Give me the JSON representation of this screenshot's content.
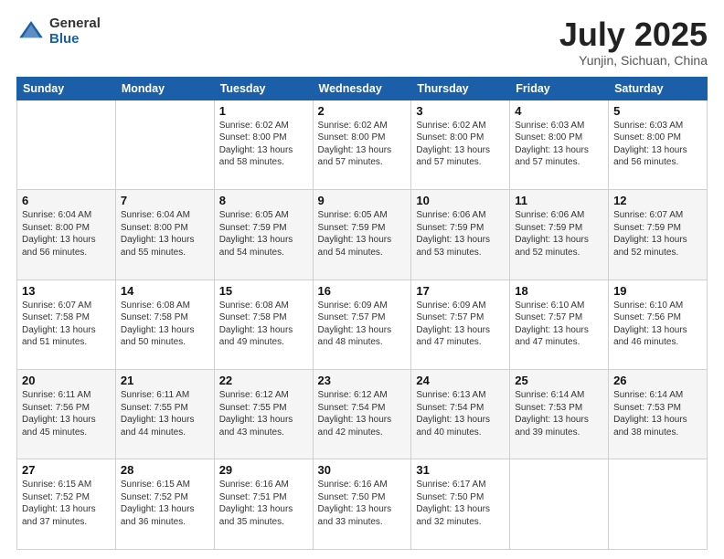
{
  "logo": {
    "general": "General",
    "blue": "Blue"
  },
  "header": {
    "month": "July 2025",
    "location": "Yunjin, Sichuan, China"
  },
  "weekdays": [
    "Sunday",
    "Monday",
    "Tuesday",
    "Wednesday",
    "Thursday",
    "Friday",
    "Saturday"
  ],
  "weeks": [
    [
      {
        "day": "",
        "info": ""
      },
      {
        "day": "",
        "info": ""
      },
      {
        "day": "1",
        "info": "Sunrise: 6:02 AM\nSunset: 8:00 PM\nDaylight: 13 hours and 58 minutes."
      },
      {
        "day": "2",
        "info": "Sunrise: 6:02 AM\nSunset: 8:00 PM\nDaylight: 13 hours and 57 minutes."
      },
      {
        "day": "3",
        "info": "Sunrise: 6:02 AM\nSunset: 8:00 PM\nDaylight: 13 hours and 57 minutes."
      },
      {
        "day": "4",
        "info": "Sunrise: 6:03 AM\nSunset: 8:00 PM\nDaylight: 13 hours and 57 minutes."
      },
      {
        "day": "5",
        "info": "Sunrise: 6:03 AM\nSunset: 8:00 PM\nDaylight: 13 hours and 56 minutes."
      }
    ],
    [
      {
        "day": "6",
        "info": "Sunrise: 6:04 AM\nSunset: 8:00 PM\nDaylight: 13 hours and 56 minutes."
      },
      {
        "day": "7",
        "info": "Sunrise: 6:04 AM\nSunset: 8:00 PM\nDaylight: 13 hours and 55 minutes."
      },
      {
        "day": "8",
        "info": "Sunrise: 6:05 AM\nSunset: 7:59 PM\nDaylight: 13 hours and 54 minutes."
      },
      {
        "day": "9",
        "info": "Sunrise: 6:05 AM\nSunset: 7:59 PM\nDaylight: 13 hours and 54 minutes."
      },
      {
        "day": "10",
        "info": "Sunrise: 6:06 AM\nSunset: 7:59 PM\nDaylight: 13 hours and 53 minutes."
      },
      {
        "day": "11",
        "info": "Sunrise: 6:06 AM\nSunset: 7:59 PM\nDaylight: 13 hours and 52 minutes."
      },
      {
        "day": "12",
        "info": "Sunrise: 6:07 AM\nSunset: 7:59 PM\nDaylight: 13 hours and 52 minutes."
      }
    ],
    [
      {
        "day": "13",
        "info": "Sunrise: 6:07 AM\nSunset: 7:58 PM\nDaylight: 13 hours and 51 minutes."
      },
      {
        "day": "14",
        "info": "Sunrise: 6:08 AM\nSunset: 7:58 PM\nDaylight: 13 hours and 50 minutes."
      },
      {
        "day": "15",
        "info": "Sunrise: 6:08 AM\nSunset: 7:58 PM\nDaylight: 13 hours and 49 minutes."
      },
      {
        "day": "16",
        "info": "Sunrise: 6:09 AM\nSunset: 7:57 PM\nDaylight: 13 hours and 48 minutes."
      },
      {
        "day": "17",
        "info": "Sunrise: 6:09 AM\nSunset: 7:57 PM\nDaylight: 13 hours and 47 minutes."
      },
      {
        "day": "18",
        "info": "Sunrise: 6:10 AM\nSunset: 7:57 PM\nDaylight: 13 hours and 47 minutes."
      },
      {
        "day": "19",
        "info": "Sunrise: 6:10 AM\nSunset: 7:56 PM\nDaylight: 13 hours and 46 minutes."
      }
    ],
    [
      {
        "day": "20",
        "info": "Sunrise: 6:11 AM\nSunset: 7:56 PM\nDaylight: 13 hours and 45 minutes."
      },
      {
        "day": "21",
        "info": "Sunrise: 6:11 AM\nSunset: 7:55 PM\nDaylight: 13 hours and 44 minutes."
      },
      {
        "day": "22",
        "info": "Sunrise: 6:12 AM\nSunset: 7:55 PM\nDaylight: 13 hours and 43 minutes."
      },
      {
        "day": "23",
        "info": "Sunrise: 6:12 AM\nSunset: 7:54 PM\nDaylight: 13 hours and 42 minutes."
      },
      {
        "day": "24",
        "info": "Sunrise: 6:13 AM\nSunset: 7:54 PM\nDaylight: 13 hours and 40 minutes."
      },
      {
        "day": "25",
        "info": "Sunrise: 6:14 AM\nSunset: 7:53 PM\nDaylight: 13 hours and 39 minutes."
      },
      {
        "day": "26",
        "info": "Sunrise: 6:14 AM\nSunset: 7:53 PM\nDaylight: 13 hours and 38 minutes."
      }
    ],
    [
      {
        "day": "27",
        "info": "Sunrise: 6:15 AM\nSunset: 7:52 PM\nDaylight: 13 hours and 37 minutes."
      },
      {
        "day": "28",
        "info": "Sunrise: 6:15 AM\nSunset: 7:52 PM\nDaylight: 13 hours and 36 minutes."
      },
      {
        "day": "29",
        "info": "Sunrise: 6:16 AM\nSunset: 7:51 PM\nDaylight: 13 hours and 35 minutes."
      },
      {
        "day": "30",
        "info": "Sunrise: 6:16 AM\nSunset: 7:50 PM\nDaylight: 13 hours and 33 minutes."
      },
      {
        "day": "31",
        "info": "Sunrise: 6:17 AM\nSunset: 7:50 PM\nDaylight: 13 hours and 32 minutes."
      },
      {
        "day": "",
        "info": ""
      },
      {
        "day": "",
        "info": ""
      }
    ]
  ]
}
